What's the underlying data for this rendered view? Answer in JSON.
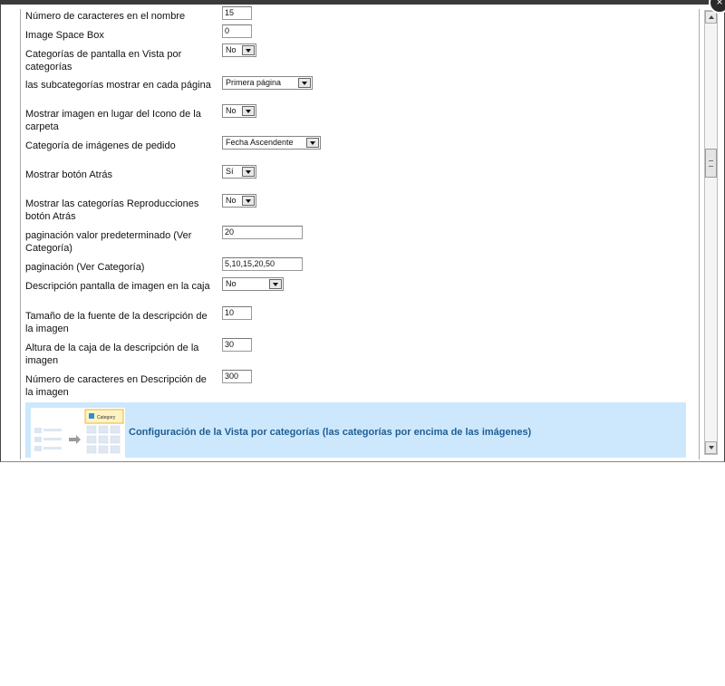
{
  "settings": [
    {
      "label": "Número de caracteres en el nombre",
      "type": "input",
      "value": "15"
    },
    {
      "label": "Image Space Box",
      "type": "input",
      "value": "0"
    },
    {
      "label": "Categorías de pantalla en Vista por categorías",
      "type": "select",
      "value": "No"
    },
    {
      "label": "las subcategorías mostrar en cada página",
      "type": "select",
      "value": "Primera página"
    },
    {
      "label": "Mostrar imagen en lugar del Icono de la carpeta",
      "type": "select",
      "value": "No"
    },
    {
      "label": "Categoría de imágenes de pedido",
      "type": "select",
      "value": "Fecha Ascendente"
    },
    {
      "label": "Mostrar botón Atrás",
      "type": "select",
      "value": "Sí"
    },
    {
      "label": "Mostrar las categorías Reproducciones botón Atrás",
      "type": "select",
      "value": "No"
    },
    {
      "label": "paginación valor predeterminado (Ver Categoría)",
      "type": "input",
      "value": "20"
    },
    {
      "label": "paginación (Ver Categoría)",
      "type": "input",
      "value": "5,10,15,20,50"
    },
    {
      "label": "Descripción pantalla de imagen en la caja",
      "type": "select",
      "value": "No"
    },
    {
      "label": "Tamaño de la fuente de la descripción de la imagen",
      "type": "input",
      "value": "10"
    },
    {
      "label": "Altura de la caja de la descripción de la imagen",
      "type": "input",
      "value": "30"
    },
    {
      "label": "Número de caracteres en Descripción de la imagen",
      "type": "input",
      "value": "300"
    }
  ],
  "banner": {
    "title": "Configuración de la Vista por categorías (las categorías por encima de las imágenes)",
    "thumb_label": "Category"
  },
  "close_icon": "×",
  "colors": {
    "banner_bg": "#cde8fd",
    "banner_title": "#1f5e94"
  }
}
